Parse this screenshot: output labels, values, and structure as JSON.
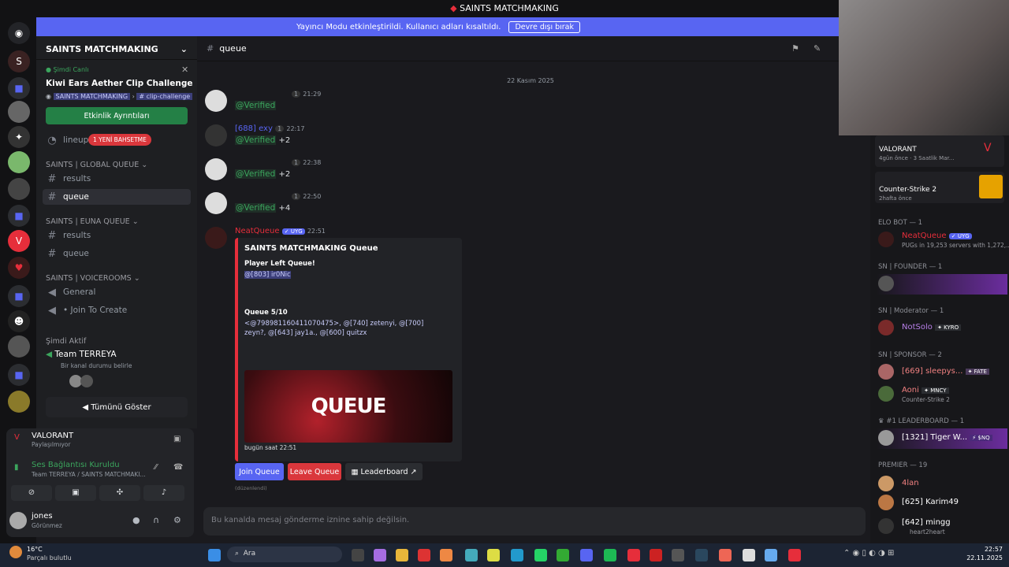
{
  "window_title": "SAINTS MATCHMAKING",
  "streamer_banner": {
    "text": "Yayıncı Modu etkinleştirildi. Kullanıcı adları kısaltıldı.",
    "button": "Devre dışı bırak"
  },
  "server": {
    "name": "SAINTS MATCHMAKING",
    "event": {
      "live": "Şimdi Canlı",
      "title": "Kiwi Ears Aether Clip Challenge",
      "location": "SAINTS MATCHMAKING",
      "channel": "clip-challenge",
      "button": "Etkinlik Ayrıntıları"
    },
    "lineups": "lineups",
    "badge": "1 YENİ BAHSETME",
    "categories": [
      {
        "name": "SAINTS | GLOBAL QUEUE",
        "channels": [
          "results",
          "queue"
        ]
      },
      {
        "name": "SAINTS | EUNA QUEUE",
        "channels": [
          "results",
          "queue"
        ]
      },
      {
        "name": "SAINTS | VOICEROOMS",
        "channels": [
          "General",
          "• Join To Create"
        ]
      }
    ],
    "active_now": "Şimdi Aktif",
    "team": "Team TERREYA",
    "team_sub": "Bir kanal durumu belirle",
    "show_all": "Tümünü Göster"
  },
  "activity": {
    "game": "VALORANT",
    "state": "Paylaşılmıyor"
  },
  "voice": {
    "status": "Ses Bağlantısı Kuruldu",
    "path": "Team TERREYA / SAINTS MATCHMAKI..."
  },
  "user": {
    "name": "jones",
    "status": "Görünmez"
  },
  "channel": {
    "name": "queue",
    "date": "22 Kasım 2025"
  },
  "messages": [
    {
      "author": "",
      "badge": "1",
      "time": "21:29",
      "mention": "@Verified",
      "extra": ""
    },
    {
      "author": "[688] exy",
      "badge": "1",
      "time": "22:17",
      "mention": "@Verified",
      "extra": "+2"
    },
    {
      "author": "",
      "badge": "1",
      "time": "22:38",
      "mention": "@Verified",
      "extra": "+2"
    },
    {
      "author": "",
      "badge": "1",
      "time": "22:50",
      "mention": "@Verified",
      "extra": "+4"
    }
  ],
  "bot": {
    "name": "NeatQueue",
    "tag": "UYG",
    "time": "22:51"
  },
  "embed": {
    "title": "SAINTS MATCHMAKING Queue",
    "line1": "Player Left Queue!",
    "line2": "@[803] ir0Nic",
    "queue": "Queue 5/10",
    "players": "<@798981160411070475>, @[740] zetenyi, @[700] zeyn?, @[643] jay1a., @[600] quitzx",
    "image_text": "QUEUE",
    "footer": "bugün saat 22:51"
  },
  "buttons": {
    "join": "Join Queue",
    "leave": "Leave Queue",
    "leaderboard": "Leaderboard"
  },
  "edited": "(düzenlendi)",
  "composer_placeholder": "Bu kanalda mesaj gönderme iznine sahip değilsin.",
  "members": {
    "cards": [
      {
        "title": "VALORANT",
        "sub": "4gün önce",
        "sub2": "3 Saatlik Mar..."
      },
      {
        "title": "Counter-Strike 2",
        "sub": "2hafta önce"
      }
    ],
    "elo": "ELO BOT — 1",
    "elo_name": "NeatQueue",
    "elo_tag": "UYG",
    "elo_sub": "PUGs in 19,253 servers with 1,272,...",
    "founder": "SN | FOUNDER — 1",
    "mod": "SN | Moderator — 1",
    "mod_name": "NotSolo",
    "mod_tag": "KYRO",
    "sponsor": "SN | SPONSOR — 2",
    "sp1": "[669] sleepys...",
    "sp1_tag": "FATE",
    "sp2": "Aoni",
    "sp2_tag": "MNCY",
    "sp2_sub": "Counter-Strike 2",
    "lb": "#1 LEADERBOARD — 1",
    "lb_name": "[1321] Tiger W...",
    "lb_tag": "$NQ",
    "premier": "PREMIER — 19",
    "p1": "4lan",
    "p2": "[625] Karim49",
    "p3": "[642] mingg",
    "p3_sub": "heart2heart"
  },
  "taskbar": {
    "weather_temp": "16°C",
    "weather_text": "Parçalı bulutlu",
    "search": "Ara",
    "time": "22:57",
    "date": "22.11.2025"
  },
  "colors": {
    "accent": "#5865f2",
    "red": "#e62e3b",
    "green": "#3ba55d"
  }
}
